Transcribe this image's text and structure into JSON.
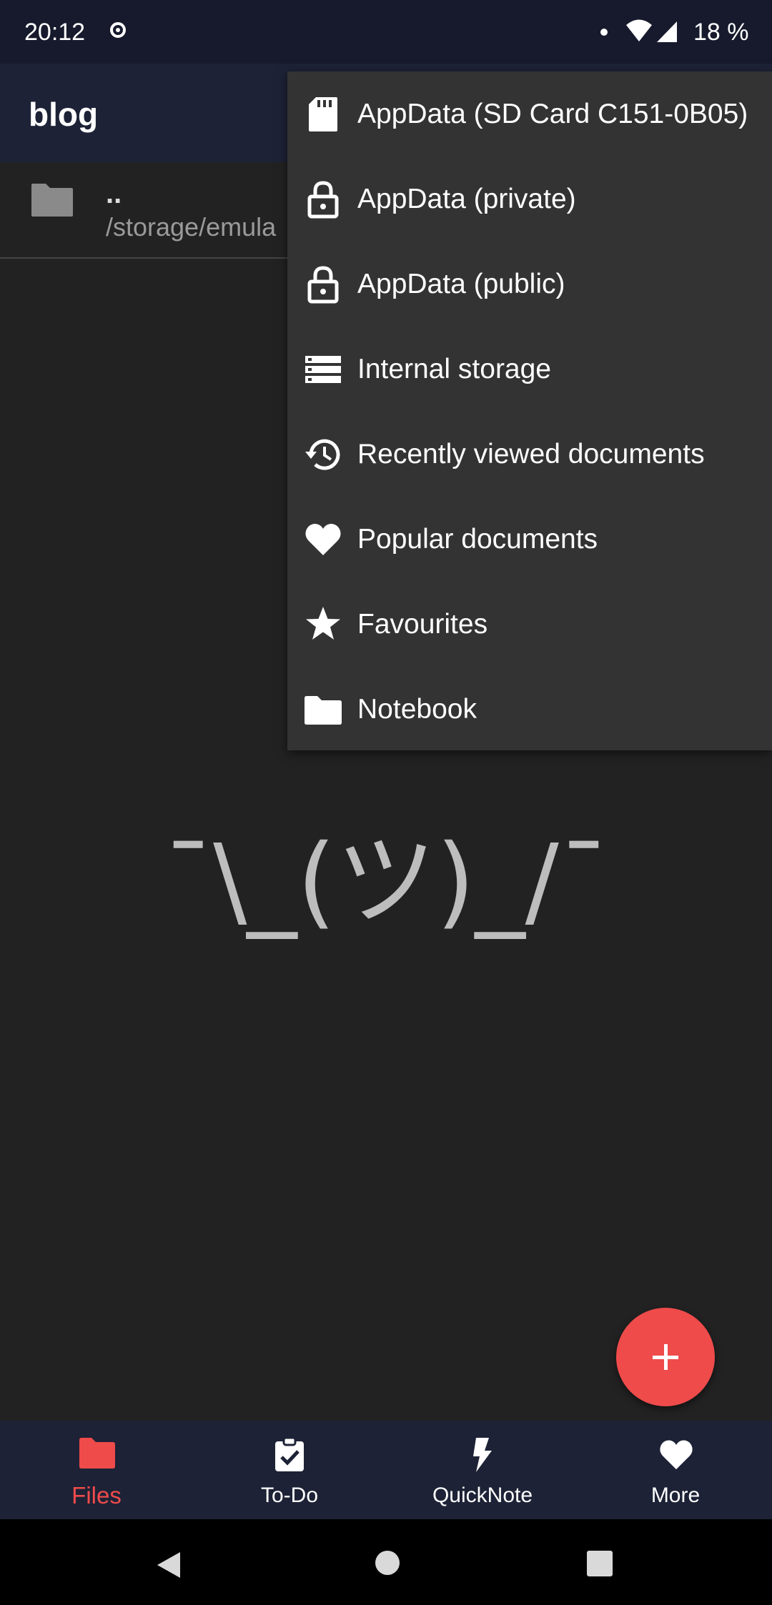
{
  "status_bar": {
    "time": "20:12",
    "battery": "18 %"
  },
  "app_bar": {
    "title": "blog"
  },
  "file_list": [
    {
      "name": "..",
      "path": "/storage/emula"
    }
  ],
  "empty_state": "¯\\_(ツ)_/¯",
  "dropdown_menu": {
    "items": [
      {
        "label": "AppData (SD Card C151-0B05)",
        "icon": "sd-card-icon"
      },
      {
        "label": "AppData (private)",
        "icon": "lock-icon"
      },
      {
        "label": "AppData (public)",
        "icon": "lock-icon"
      },
      {
        "label": "Internal storage",
        "icon": "storage-icon"
      },
      {
        "label": "Recently viewed documents",
        "icon": "history-icon"
      },
      {
        "label": "Popular documents",
        "icon": "heart-icon"
      },
      {
        "label": "Favourites",
        "icon": "star-icon"
      },
      {
        "label": "Notebook",
        "icon": "folder-icon"
      }
    ]
  },
  "bottom_nav": {
    "tabs": [
      {
        "label": "Files",
        "icon": "folder-icon",
        "active": true
      },
      {
        "label": "To-Do",
        "icon": "clipboard-check-icon"
      },
      {
        "label": "QuickNote",
        "icon": "lightning-icon"
      },
      {
        "label": "More",
        "icon": "heart-icon"
      }
    ]
  },
  "colors": {
    "accent": "#ef4b4b",
    "bar_background": "#1d2236",
    "menu_background": "#333333",
    "page_background": "#222222"
  }
}
